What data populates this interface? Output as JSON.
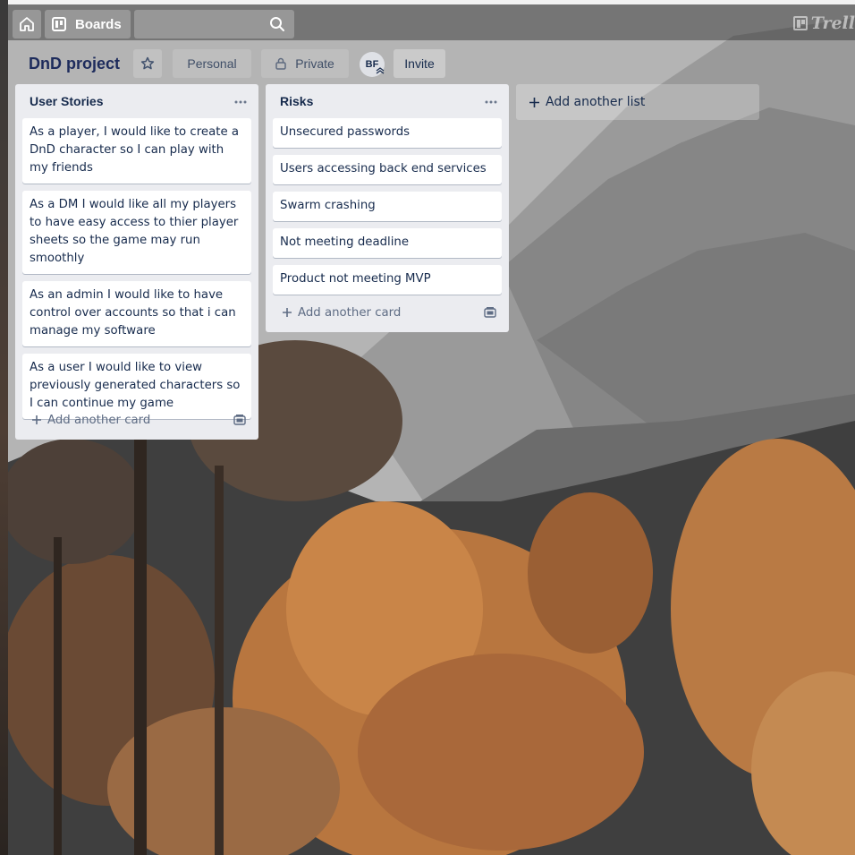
{
  "header": {
    "boards_label": "Boards",
    "search_value": "",
    "logo_text": "Trell"
  },
  "board": {
    "title": "DnD project",
    "visibility_team": "Personal",
    "visibility_privacy": "Private",
    "member_initials": "BF",
    "invite_label": "Invite"
  },
  "lists": [
    {
      "title": "User Stories",
      "cards": [
        "As a player, I would like to create a DnD character so I can play with my friends",
        "As a DM I would like all my players to have easy access to thier player sheets so the game may run smoothly",
        "As an admin I would like to have control over accounts so that i can manage my software",
        "As a user I would like to view previously generated characters so I can continue my game"
      ],
      "add_card_label": "Add another card"
    },
    {
      "title": "Risks",
      "cards": [
        "Unsecured passwords",
        "Users accessing back end services",
        "Swarm crashing",
        "Not meeting deadline",
        "Product not meeting MVP"
      ],
      "add_card_label": "Add another card"
    }
  ],
  "add_list_label": "Add another list",
  "colors": {
    "list_bg": "#ebecf0",
    "card_bg": "#ffffff",
    "text": "#172b4d",
    "muted_text": "#5e6c84",
    "board_title": "#1d2b5c"
  },
  "icons": [
    "home-icon",
    "boards-icon",
    "search-icon",
    "star-icon",
    "lock-icon",
    "more-icon",
    "plus-icon",
    "template-icon"
  ]
}
